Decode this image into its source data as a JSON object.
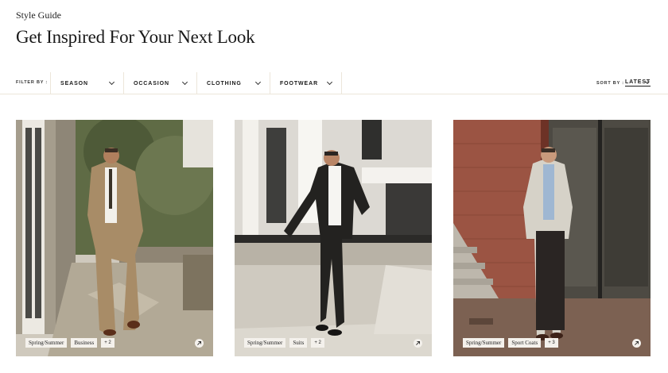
{
  "header": {
    "eyebrow": "Style Guide",
    "title": "Get Inspired For Your Next Look"
  },
  "filters": {
    "label": "FILTER BY :",
    "items": [
      {
        "label": "SEASON"
      },
      {
        "label": "OCCASION"
      },
      {
        "label": "CLOTHING"
      },
      {
        "label": "FOOTWEAR"
      }
    ]
  },
  "sort": {
    "label": "SORT BY :",
    "value": "LATEST"
  },
  "cards": [
    {
      "tags": [
        "Spring/Summer",
        "Business"
      ],
      "more": "+ 2",
      "icon": "arrow-up-right-icon"
    },
    {
      "tags": [
        "Spring/Summer",
        "Suits"
      ],
      "more": "+ 2",
      "icon": "arrow-up-right-icon"
    },
    {
      "tags": [
        "Spring/Summer",
        "Sport Coats"
      ],
      "more": "+ 3",
      "icon": "arrow-up-right-icon"
    }
  ],
  "colors": {
    "divider": "#ece6da",
    "tag_bg": "#f4f1ec",
    "text": "#1a1a1a"
  }
}
